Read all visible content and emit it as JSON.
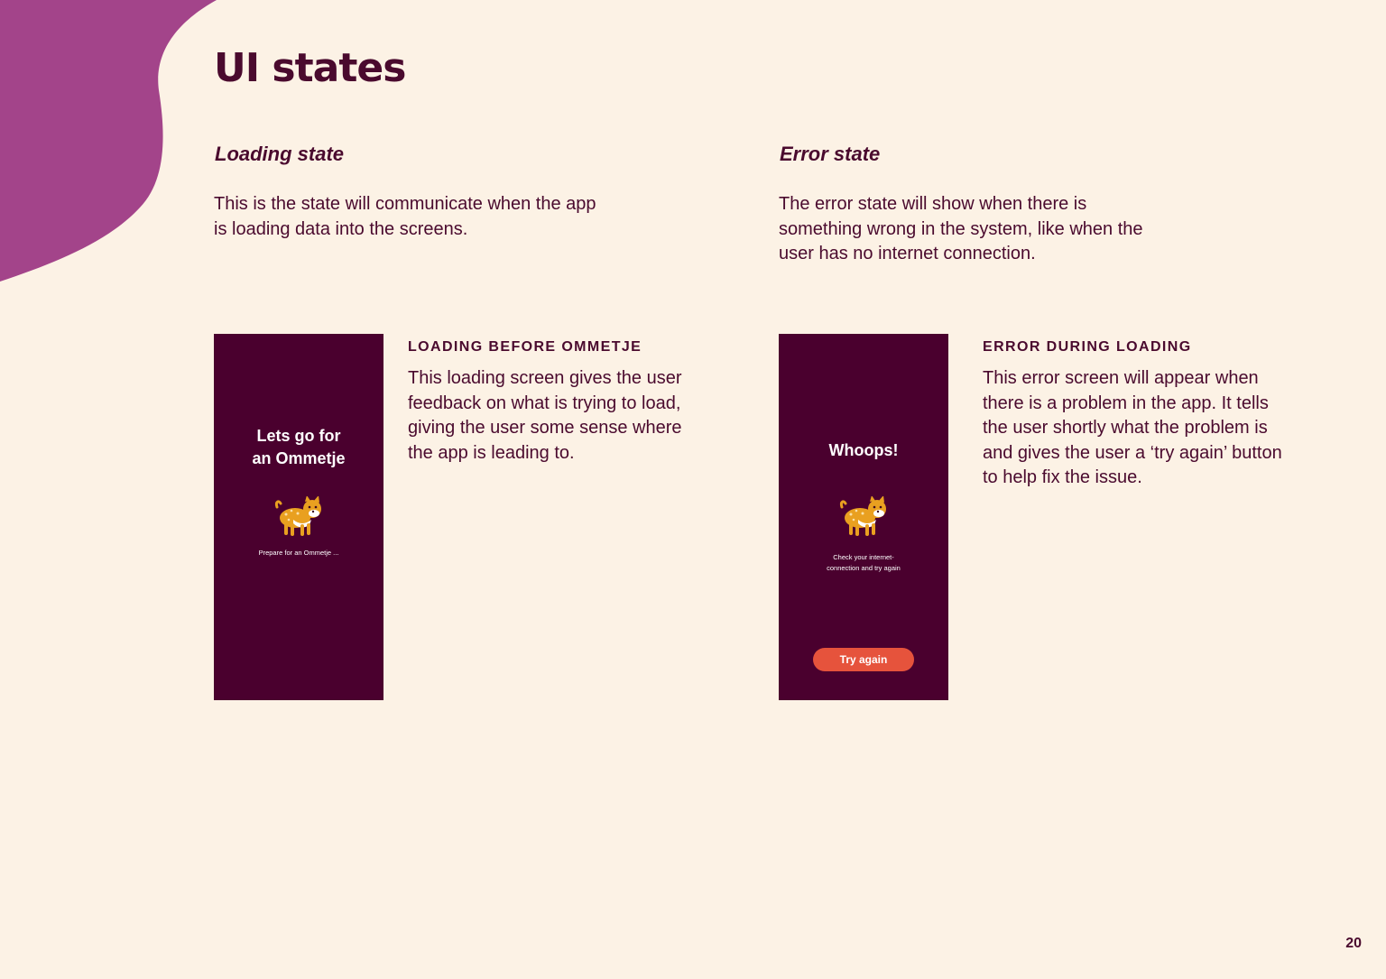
{
  "page": {
    "title": "UI states",
    "number": "20"
  },
  "colors": {
    "background": "#fcf2e5",
    "blob": "#a3448a",
    "text": "#4a0a2e",
    "phone_background": "#4a002e",
    "button": "#e6533c",
    "mascot_body": "#e9a020"
  },
  "loading_section": {
    "heading": "Loading state",
    "description": "This is the state will communicate when the app\nis loading data into the screens.",
    "card": {
      "label": "LOADING BEFORE OMMETJE",
      "description": "This loading screen gives the user feedback on what is trying to load, giving the user some sense where the app is leading to.",
      "phone": {
        "heading": "Lets go for\nan Ommetje",
        "subtext": "Prepare for an Ommetje ...",
        "mascot_icon": "cheetah-mascot-icon"
      }
    }
  },
  "error_section": {
    "heading": "Error state",
    "description": "The error state will show when there is\nsomething wrong in the system, like when the\nuser has no internet connection.",
    "card": {
      "label": "ERROR DURING LOADING",
      "description": "This error screen will appear when there is a problem in the app. It tells the user shortly what the problem is and gives the user a ‘try again’ button to help fix the issue.",
      "phone": {
        "heading": "Whoops!",
        "subtext": "Check your internet-\nconnection and try again",
        "button_label": "Try again",
        "mascot_icon": "cheetah-mascot-icon"
      }
    }
  }
}
